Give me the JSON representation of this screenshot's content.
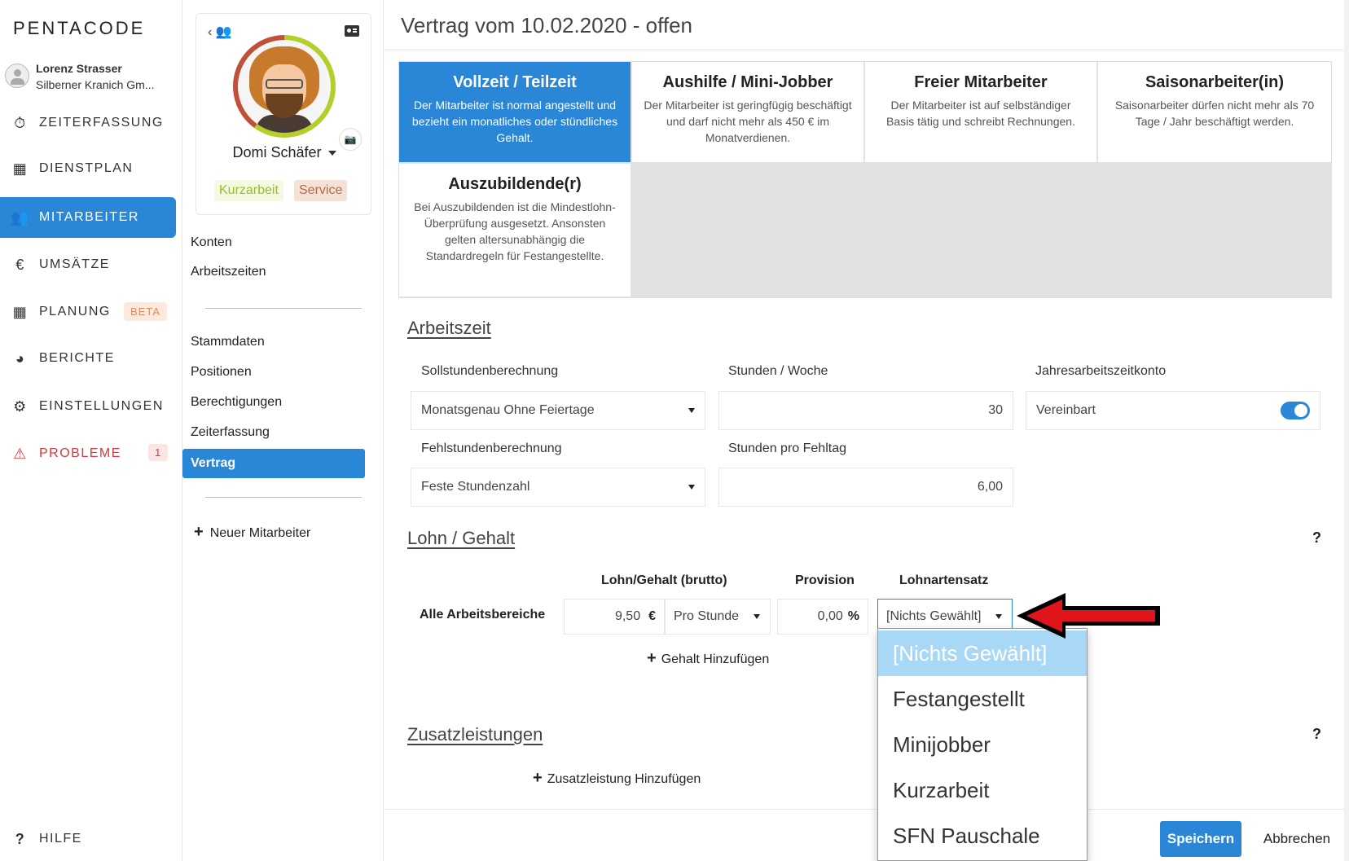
{
  "brand": {
    "logo": "PENTACODE"
  },
  "user": {
    "name": "Lorenz Strasser",
    "company": "Silberner Kranich Gm..."
  },
  "nav": {
    "items": [
      {
        "label": "ZEITERFASSUNG",
        "icon": "stopwatch-icon"
      },
      {
        "label": "DIENSTPLAN",
        "icon": "table-icon"
      },
      {
        "label": "MITARBEITER",
        "icon": "users-icon"
      },
      {
        "label": "UMSÄTZE",
        "icon": "euro-icon"
      },
      {
        "label": "PLANUNG",
        "icon": "calendar-icon",
        "badge": "BETA"
      },
      {
        "label": "BERICHTE",
        "icon": "pie-chart-icon"
      },
      {
        "label": "EINSTELLUNGEN",
        "icon": "gear-icon"
      },
      {
        "label": "PROBLEME",
        "icon": "warning-icon",
        "badge": "1"
      }
    ],
    "help": "HILFE",
    "active_color": "#2a86d6",
    "danger_color": "#d9363e"
  },
  "employee": {
    "name": "Domi Schäfer",
    "tags": [
      "Kurzarbeit",
      "Service"
    ]
  },
  "subnav": {
    "group1": [
      "Konten",
      "Arbeitszeiten"
    ],
    "group2": [
      "Stammdaten",
      "Positionen",
      "Berechtigungen",
      "Zeiterfassung",
      "Vertrag"
    ],
    "new_employee": "Neuer Mitarbeiter"
  },
  "page": {
    "title": "Vertrag vom 10.02.2020 - offen"
  },
  "contract_types": [
    {
      "title": "Vollzeit / Teilzeit",
      "desc": "Der Mitarbeiter ist normal angestellt und bezieht ein monatliches oder stündliches Gehalt."
    },
    {
      "title": "Aushilfe / Mini-Jobber",
      "desc": "Der Mitarbeiter ist geringfügig beschäftigt und darf nicht mehr als 450 € im Monatverdienen."
    },
    {
      "title": "Freier Mitarbeiter",
      "desc": "Der Mitarbeiter ist auf selbständiger Basis tätig und schreibt Rechnungen."
    },
    {
      "title": "Saisonarbeiter(in)",
      "desc": "Saisonarbeiter dürfen nicht mehr als 70 Tage / Jahr beschäftigt werden."
    },
    {
      "title": "Auszubildende(r)",
      "desc": "Bei Auszubildenden ist die Mindestlohn-Überprüfung ausgesetzt. Ansonsten gelten altersunabhängig die Standardregeln für Festangestellte."
    }
  ],
  "arbeitszeit": {
    "title": "Arbeitszeit",
    "soll_label": "Sollstundenberechnung",
    "soll_value": "Monatsgenau Ohne Feiertage",
    "stunden_woche_label": "Stunden / Woche",
    "stunden_woche_value": "30",
    "jahres_label": "Jahresarbeitszeitkonto",
    "jahres_value": "Vereinbart",
    "jahres_enabled": true,
    "fehl_label": "Fehlstundenberechnung",
    "fehl_value": "Feste Stundenzahl",
    "fehltag_label": "Stunden pro Fehltag",
    "fehltag_value": "6,00"
  },
  "lohn": {
    "title": "Lohn / Gehalt",
    "help": "?",
    "col_brutto": "Lohn/Gehalt (brutto)",
    "col_provision": "Provision",
    "col_lohnart": "Lohnartensatz",
    "row_label": "Alle Arbeitsbereiche",
    "brutto_value": "9,50",
    "brutto_unit": "€",
    "period": "Pro Stunde",
    "provision_value": "0,00",
    "provision_unit": "%",
    "lohnart_value": "[Nichts Gewählt]",
    "add_label": "Gehalt Hinzufügen",
    "dropdown_options": [
      "[Nichts Gewählt]",
      "Festangestellt",
      "Minijobber",
      "Kurzarbeit",
      "SFN Pauschale"
    ]
  },
  "zusatz": {
    "title": "Zusatzleistungen",
    "help": "?",
    "add_label": "Zusatzleistung Hinzufügen"
  },
  "footer": {
    "save": "Speichern",
    "cancel": "Abbrechen"
  }
}
